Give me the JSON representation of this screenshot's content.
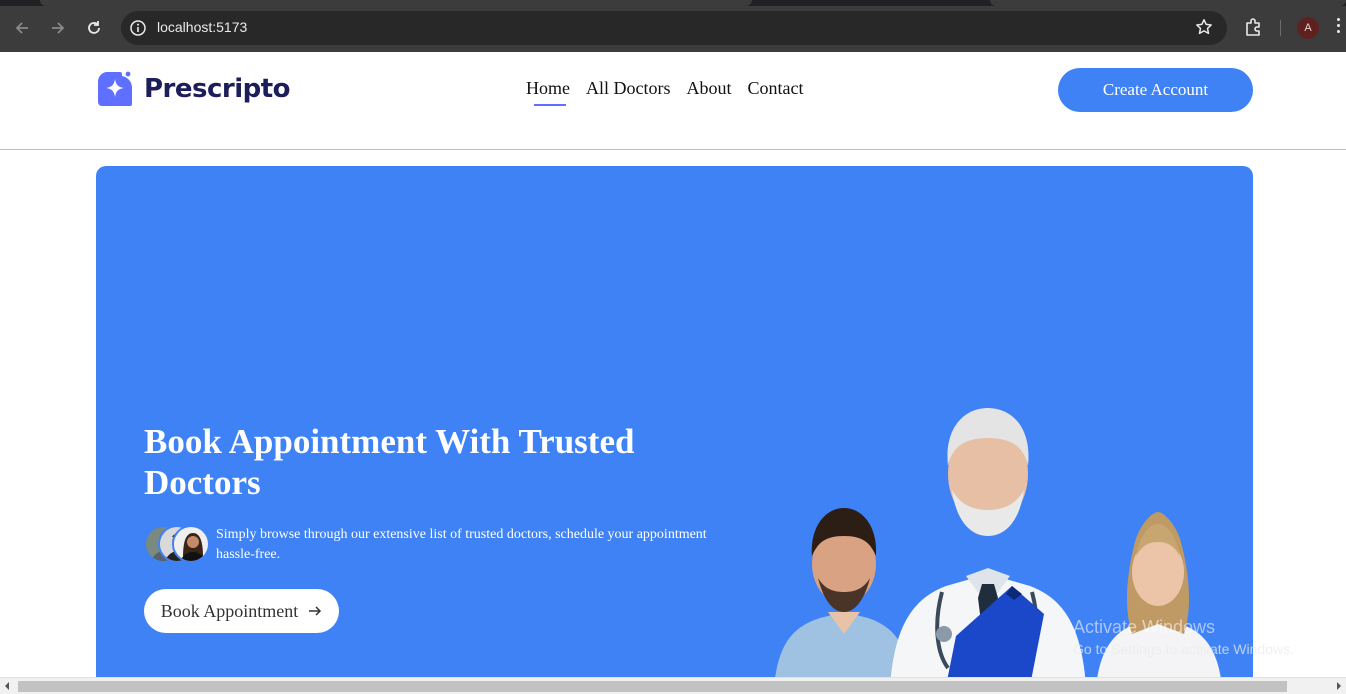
{
  "browser": {
    "url": "localhost:5173",
    "profile_initial": "A",
    "icons": [
      "back-icon",
      "forward-icon",
      "reload-icon",
      "site-info-icon",
      "bookmark-star-icon",
      "extensions-icon",
      "kebab-menu-icon"
    ]
  },
  "header": {
    "brand": "Prescripto",
    "nav": [
      {
        "label": "Home",
        "active": true
      },
      {
        "label": "All Doctors",
        "active": false
      },
      {
        "label": "About",
        "active": false
      },
      {
        "label": "Contact",
        "active": false
      }
    ],
    "cta_label": "Create Account"
  },
  "hero": {
    "title": "Book Appointment With Trusted Doctors",
    "description": "Simply browse through our extensive list of trusted doctors, schedule your appointment hassle-free.",
    "button_label": "Book Appointment",
    "button_icon": "arrow-right-icon"
  },
  "watermark": {
    "line1": "Activate Windows",
    "line2": "Go to Settings to activate Windows."
  },
  "colors": {
    "primary": "#3e82f5",
    "brand_text": "#1d1d5b",
    "logo": "#5f6fff",
    "chrome_bg": "#3c3c3c"
  }
}
